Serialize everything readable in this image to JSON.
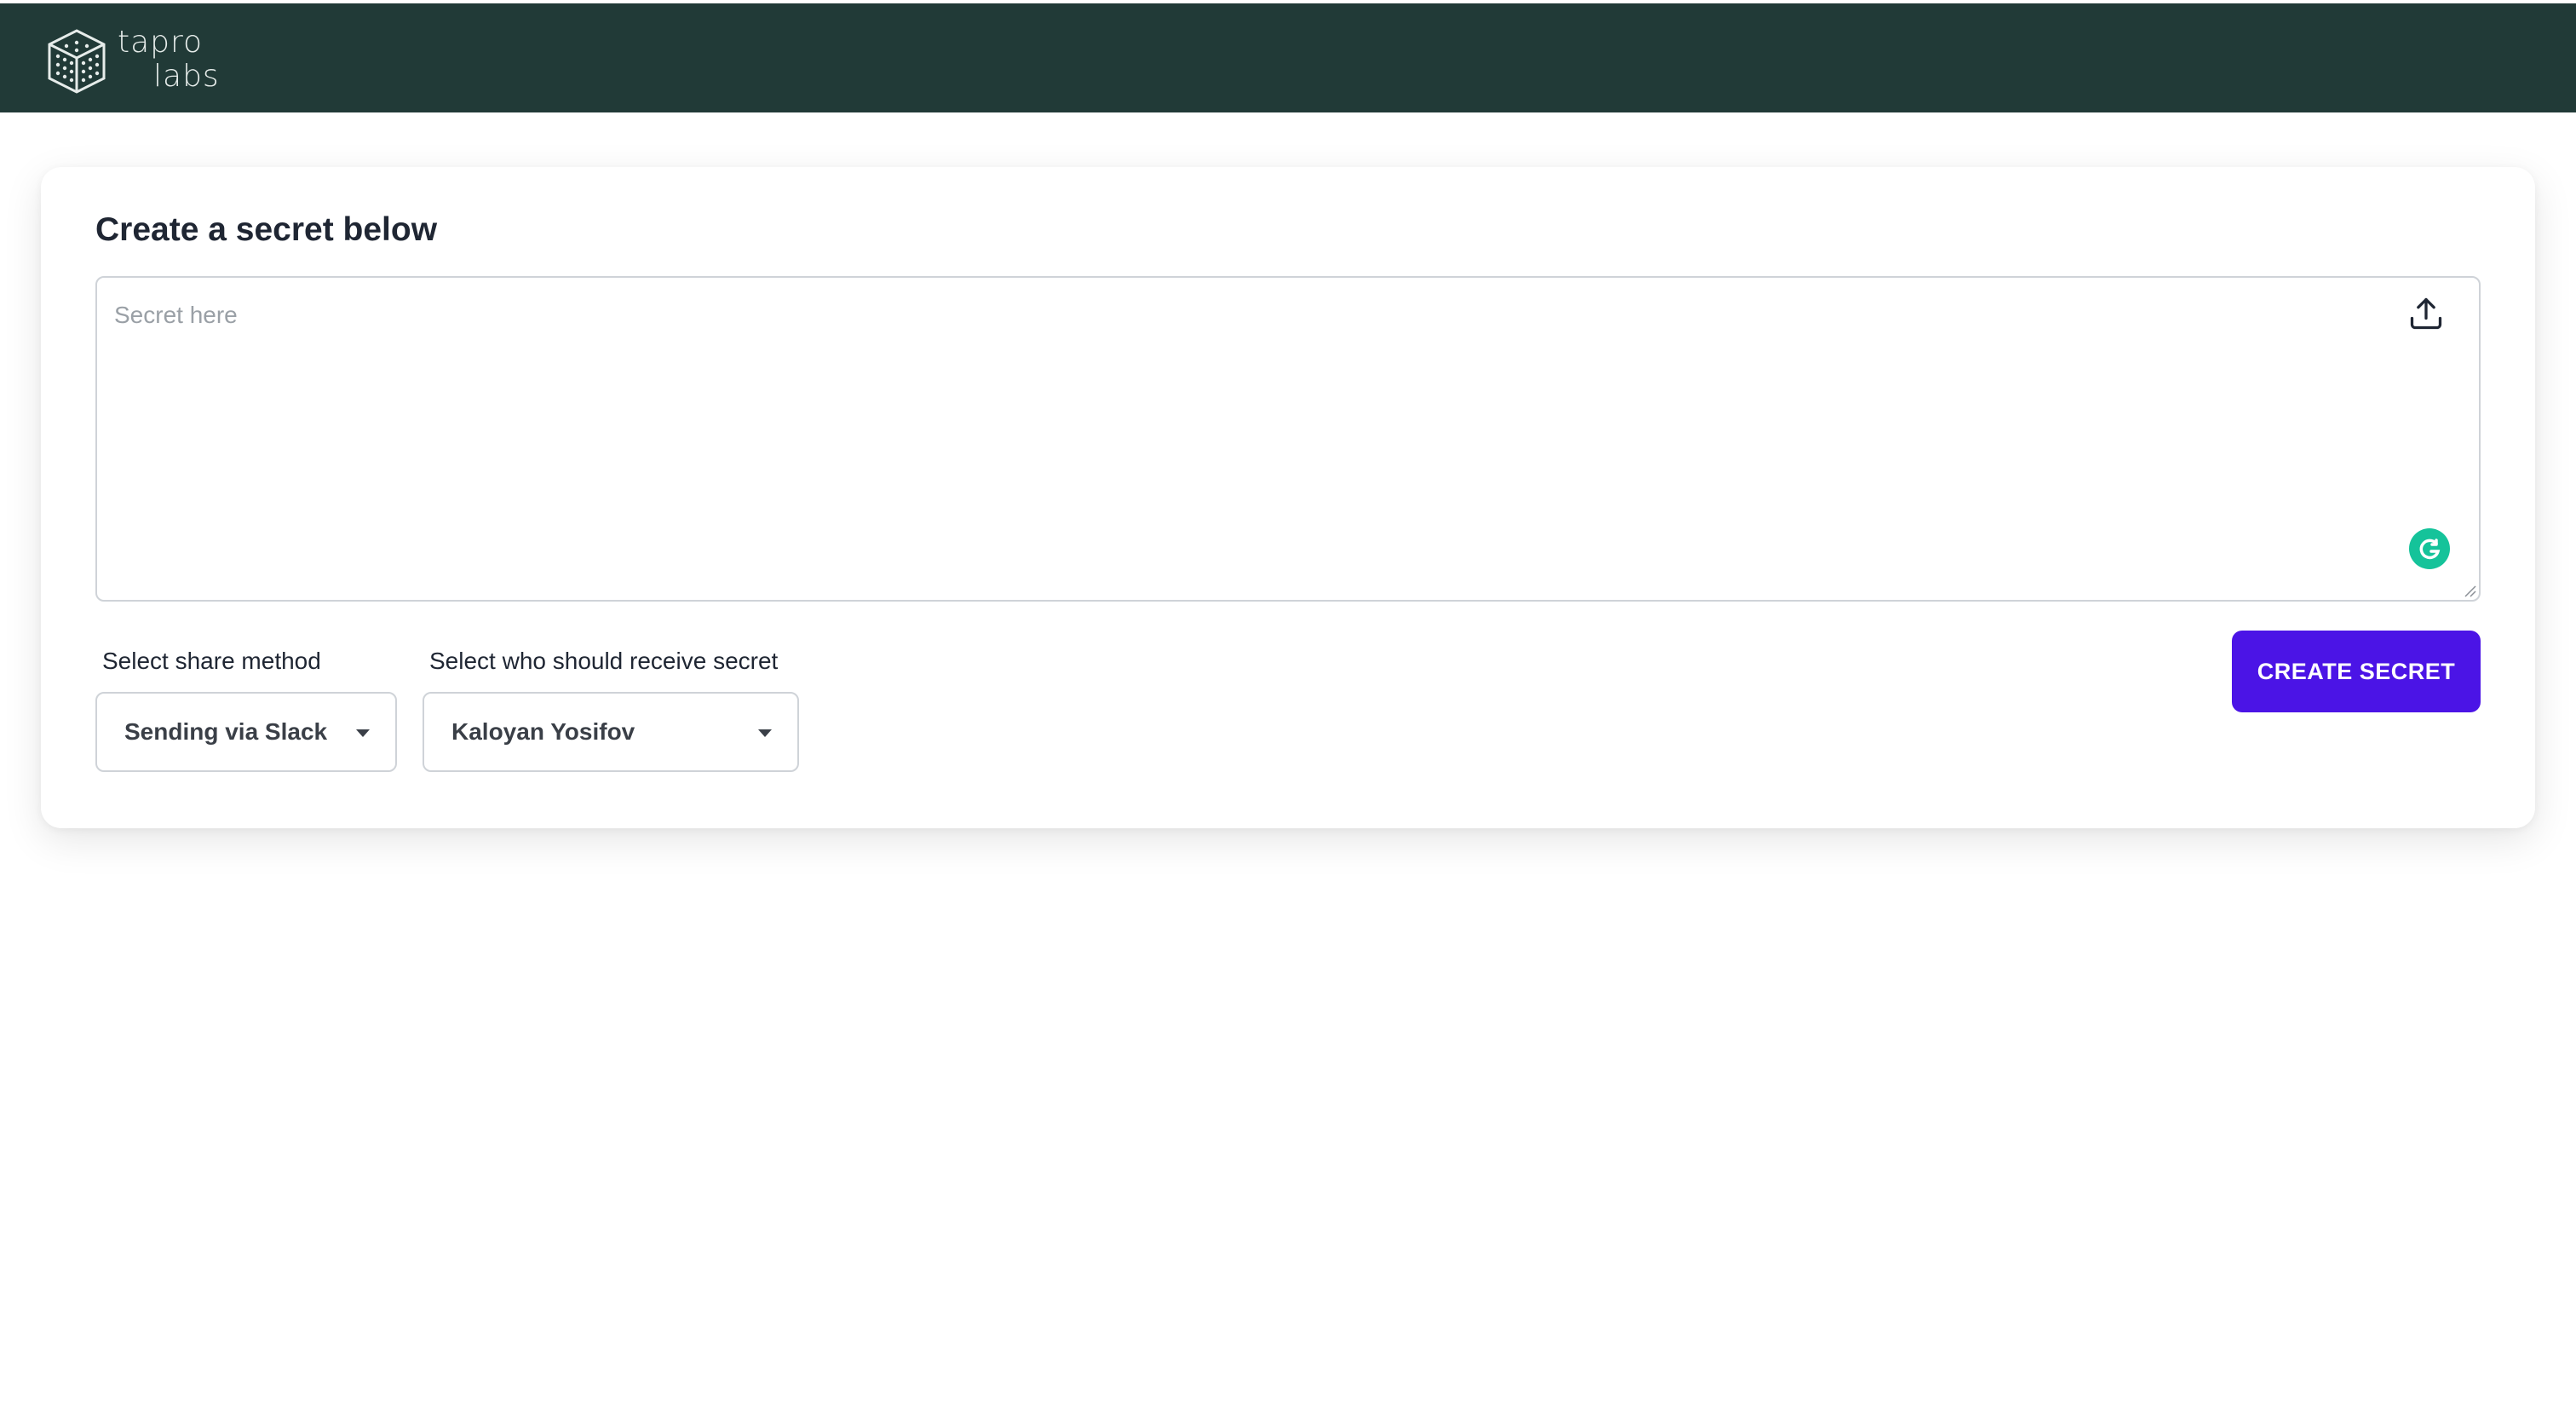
{
  "brand": {
    "name_line1": "tapro",
    "name_line2": "labs",
    "header_color": "#213a37"
  },
  "form": {
    "title": "Create a secret below",
    "secret_placeholder": "Secret here",
    "share_method_label": "Select share method",
    "share_method_value": "Sending via Slack",
    "recipient_label": "Select who should receive secret",
    "recipient_value": "Kaloyan Yosifov",
    "create_button": "CREATE SECRET",
    "accent_color": "#4b14e6"
  },
  "icons": {
    "upload": "upload-icon",
    "grammarly": "grammarly-icon",
    "dropdown": "chevron-down-icon"
  }
}
